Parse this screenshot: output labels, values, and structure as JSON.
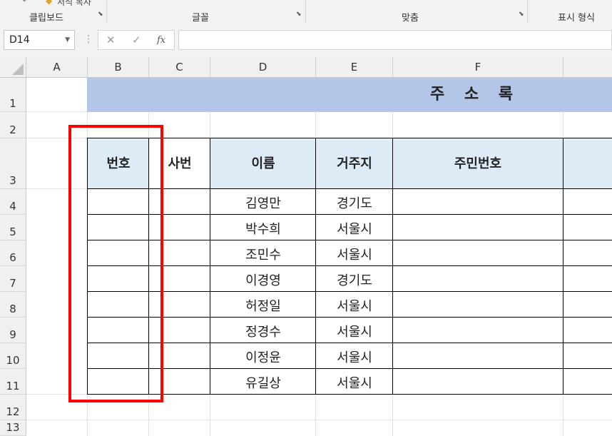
{
  "ribbon": {
    "top_partial_label": "서식 복사",
    "groups": [
      {
        "id": "clipboard",
        "label": "클립보드"
      },
      {
        "id": "font",
        "label": "글꼴"
      },
      {
        "id": "alignment",
        "label": "맞춤"
      },
      {
        "id": "number",
        "label": "표시 형식"
      }
    ]
  },
  "formula_bar": {
    "name_box": "D14",
    "cancel_symbol": "✕",
    "enter_symbol": "✓",
    "fx_label": "fx",
    "formula": ""
  },
  "sheet": {
    "columns": [
      "A",
      "B",
      "C",
      "D",
      "E",
      "F"
    ],
    "rows": [
      "1",
      "2",
      "3",
      "4",
      "5",
      "6",
      "7",
      "8",
      "9",
      "10",
      "11",
      "12",
      "13"
    ],
    "title": "주 소 록",
    "table": {
      "headers": [
        "번호",
        "사번",
        "이름",
        "거주지",
        "주민번호"
      ],
      "rows": [
        {
          "name": "김영만",
          "region": "경기도"
        },
        {
          "name": "박수희",
          "region": "서울시"
        },
        {
          "name": "조민수",
          "region": "서울시"
        },
        {
          "name": "이경영",
          "region": "경기도"
        },
        {
          "name": "허정일",
          "region": "서울시"
        },
        {
          "name": "정경수",
          "region": "서울시"
        },
        {
          "name": "이정윤",
          "region": "서울시"
        },
        {
          "name": "유길상",
          "region": "서울시"
        }
      ]
    }
  },
  "colors": {
    "title_fill": "#b4c6e7",
    "header_fill": "#ddebf7",
    "highlight_box": "#ff0000"
  }
}
